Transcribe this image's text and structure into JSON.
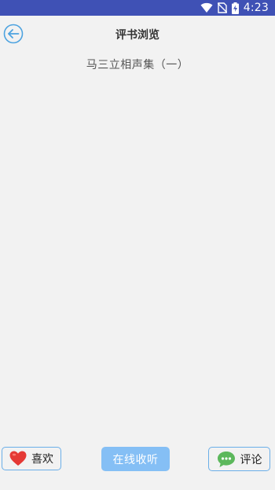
{
  "status_bar": {
    "time": "4:23",
    "icons": [
      "wifi-icon",
      "no-sim-icon",
      "battery-charging-icon"
    ],
    "background": "#3f51b5"
  },
  "header": {
    "back_icon": "back-arrow-icon",
    "title": "评书浏览"
  },
  "content": {
    "book_title": "马三立相声集（一）"
  },
  "bottom_bar": {
    "like": {
      "icon": "heart-icon",
      "label": "喜欢"
    },
    "listen": {
      "label": "在线收听"
    },
    "comment": {
      "icon": "chat-bubble-icon",
      "label": "评论"
    }
  },
  "colors": {
    "accent": "#6aaee8",
    "listen_button": "#85bff5",
    "heart": "#e53935",
    "chat": "#5cb85c"
  }
}
